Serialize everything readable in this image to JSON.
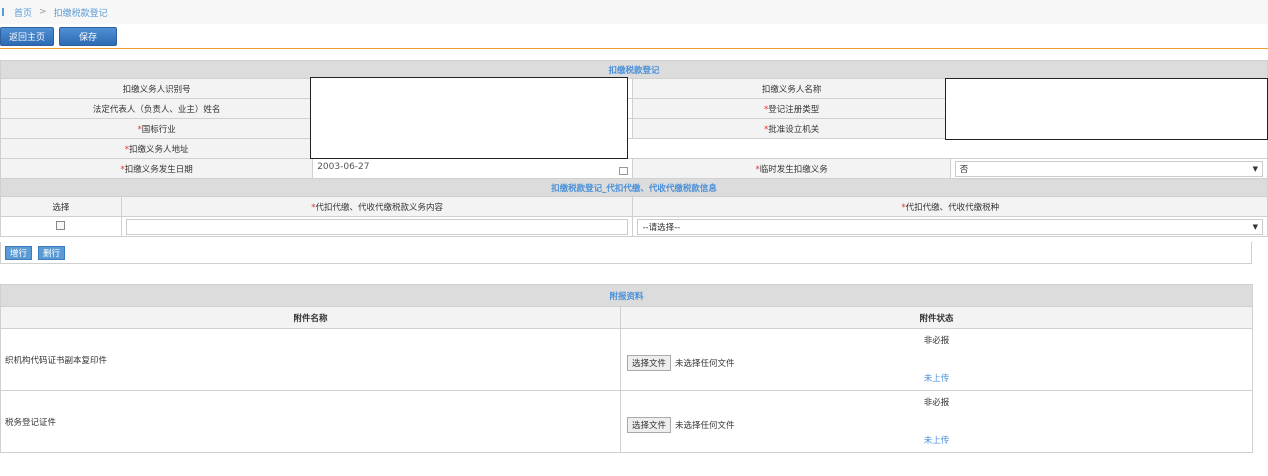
{
  "breadcrumb": {
    "home": "首页",
    "separator": ">",
    "current": "扣缴税款登记"
  },
  "toolbar": {
    "back_label": "返回主页",
    "save_label": "保存"
  },
  "section1": {
    "title": "扣缴税款登记",
    "fields": {
      "id_number_label": "扣缴义务人识别号",
      "name_label": "扣缴义务人名称",
      "legal_rep_label": "法定代表人（负责人、业主）姓名",
      "reg_type_label": "登记注册类型",
      "industry_label": "国标行业",
      "approval_org_label": "批准设立机关",
      "address_label": "扣缴义务人地址",
      "occur_date_label": "扣缴义务发生日期",
      "occur_date_value": "2003-06-27",
      "temp_label": "临时发生扣缴义务",
      "temp_value": "否"
    },
    "required_mark": "*"
  },
  "section2": {
    "title": "扣缴税款登记_代扣代缴、代收代缴税款信息",
    "col_select": "选择",
    "col_content": "代扣代缴、代收代缴税款义务内容",
    "col_tax_type": "代扣代缴、代收代缴税种",
    "tax_type_placeholder": "--请选择--",
    "add_row": "增行",
    "delete_row": "删行"
  },
  "attachments": {
    "title": "附报资料",
    "col_name": "附件名称",
    "col_status": "附件状态",
    "rows": [
      {
        "name": "织机构代码证书副本复印件",
        "required": "非必报",
        "file_button": "选择文件",
        "file_status": "未选择任何文件",
        "upload": "未上传"
      },
      {
        "name": "税务登记证件",
        "required": "非必报",
        "file_button": "选择文件",
        "file_status": "未选择任何文件",
        "upload": "未上传"
      }
    ]
  }
}
